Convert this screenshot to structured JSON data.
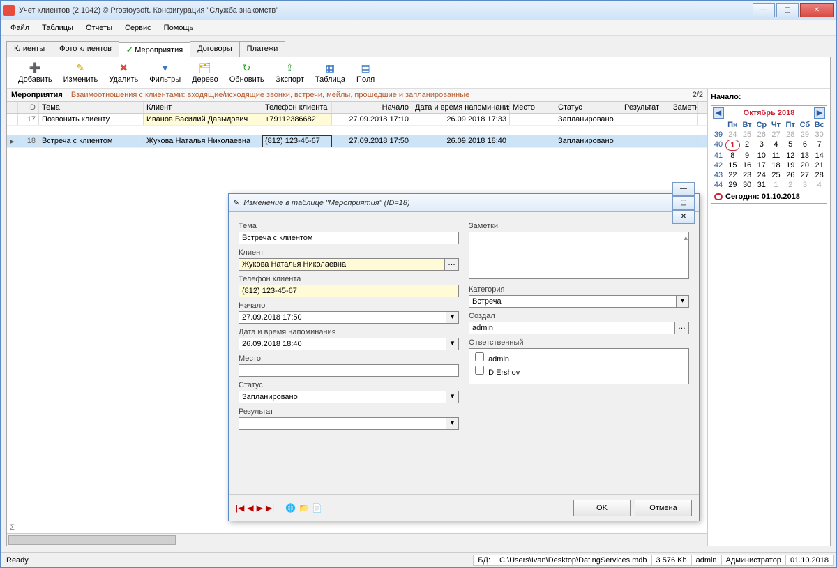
{
  "window": {
    "title": "Учет клиентов (2.1042) © Prostoysoft. Конфигурация \"Служба знакомств\""
  },
  "menu": [
    "Файл",
    "Таблицы",
    "Отчеты",
    "Сервис",
    "Помощь"
  ],
  "tabs": [
    {
      "label": "Клиенты"
    },
    {
      "label": "Фото клиентов"
    },
    {
      "label": "Мероприятия",
      "active": true,
      "check": true
    },
    {
      "label": "Договоры"
    },
    {
      "label": "Платежи"
    }
  ],
  "toolbar": [
    {
      "label": "Добавить",
      "icon": "➕",
      "color": "#2a9d2a"
    },
    {
      "label": "Изменить",
      "icon": "✎",
      "color": "#d9a400"
    },
    {
      "label": "Удалить",
      "icon": "✖",
      "color": "#d94b3f"
    },
    {
      "label": "Фильтры",
      "icon": "▼",
      "color": "#3a79c4"
    },
    {
      "label": "Дерево",
      "icon": "🗂",
      "color": "#d9a400"
    },
    {
      "label": "Обновить",
      "icon": "↻",
      "color": "#2a9d2a"
    },
    {
      "label": "Экспорт",
      "icon": "⇪",
      "color": "#2a9d2a"
    },
    {
      "label": "Таблица",
      "icon": "▦",
      "color": "#3a79c4"
    },
    {
      "label": "Поля",
      "icon": "▤",
      "color": "#3a79c4"
    }
  ],
  "grid": {
    "name": "Мероприятия",
    "desc": "Взаимоотношения с клиентами: входящие/исходящие звонки, встречи, мейлы, прошедшие и запланированные",
    "counter": "2/2",
    "columns": [
      "ID",
      "Тема",
      "Клиент",
      "Телефон клиента",
      "Начало",
      "Дата и время напоминания",
      "Место",
      "Статус",
      "Результат",
      "Заметки"
    ],
    "rows": [
      {
        "id": "17",
        "tema": "Позвонить клиенту",
        "client": "Иванов Василий Давыдович",
        "phone": "+79112386682",
        "start": "27.09.2018 17:10",
        "remind": "26.09.2018 17:33",
        "place": "",
        "status": "Запланировано",
        "result": "",
        "notes": ""
      },
      {
        "id": "18",
        "tema": "Встреча с клиентом",
        "client": "Жукова Наталья Николаевна",
        "phone": "(812) 123-45-67",
        "start": "27.09.2018 17:50",
        "remind": "26.09.2018 18:40",
        "place": "",
        "status": "Запланировано",
        "result": "",
        "notes": "",
        "selected": true
      }
    ],
    "sigma": "Σ"
  },
  "calendar": {
    "label": "Начало:",
    "month": "Октябрь 2018",
    "dow": [
      "Пн",
      "Вт",
      "Ср",
      "Чт",
      "Пт",
      "Сб",
      "Вс"
    ],
    "weeks": [
      {
        "wk": "39",
        "d": [
          "24",
          "25",
          "26",
          "27",
          "28",
          "29",
          "30"
        ],
        "dim": [
          0,
          1,
          2,
          3,
          4,
          5,
          6
        ]
      },
      {
        "wk": "40",
        "d": [
          "1",
          "2",
          "3",
          "4",
          "5",
          "6",
          "7"
        ],
        "today": 0
      },
      {
        "wk": "41",
        "d": [
          "8",
          "9",
          "10",
          "11",
          "12",
          "13",
          "14"
        ]
      },
      {
        "wk": "42",
        "d": [
          "15",
          "16",
          "17",
          "18",
          "19",
          "20",
          "21"
        ]
      },
      {
        "wk": "43",
        "d": [
          "22",
          "23",
          "24",
          "25",
          "26",
          "27",
          "28"
        ]
      },
      {
        "wk": "44",
        "d": [
          "29",
          "30",
          "31",
          "1",
          "2",
          "3",
          "4"
        ],
        "dim": [
          3,
          4,
          5,
          6
        ]
      }
    ],
    "today_label": "Сегодня: 01.10.2018"
  },
  "dialog": {
    "title": "Изменение в таблице \"Мероприятия\" (ID=18)",
    "labels": {
      "tema": "Тема",
      "client": "Клиент",
      "phone": "Телефон клиента",
      "start": "Начало",
      "remind": "Дата и время напоминания",
      "place": "Место",
      "status": "Статус",
      "result": "Результат",
      "notes": "Заметки",
      "category": "Категория",
      "creator": "Создал",
      "responsible": "Ответственный"
    },
    "values": {
      "tema": "Встреча с клиентом",
      "client": "Жукова Наталья Николаевна",
      "phone": "(812) 123-45-67",
      "start": "27.09.2018 17:50",
      "remind": "26.09.2018 18:40",
      "place": "",
      "status": "Запланировано",
      "result": "",
      "notes": "",
      "category": "Встреча",
      "creator": "admin"
    },
    "responsible_options": [
      "admin",
      "D.Ershov"
    ],
    "buttons": {
      "ok": "OK",
      "cancel": "Отмена"
    }
  },
  "statusbar": {
    "ready": "Ready",
    "db_label": "БД:",
    "db_path": "C:\\Users\\Ivan\\Desktop\\DatingServices.mdb",
    "size": "3 576 Kb",
    "user": "admin",
    "role": "Администратор",
    "date": "01.10.2018"
  }
}
